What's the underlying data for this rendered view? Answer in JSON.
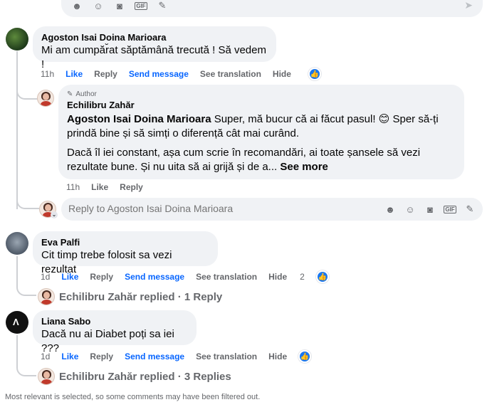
{
  "top_composer": {
    "icons": [
      "avatar-sticker-icon",
      "emoji-icon",
      "camera-icon",
      "gif-icon",
      "sticker-icon",
      "send-icon"
    ]
  },
  "comments": [
    {
      "author": "Agoston Isai Doina Marioara",
      "text": "Mi am cumpăr̆at săptămână trecută ! Să vedem !",
      "time": "11h",
      "like": "Like",
      "reply": "Reply",
      "send_message": "Send message",
      "see_translation": "See translation",
      "hide": "Hide"
    },
    {
      "author": "Eva Palfi",
      "text": "Cit timp trebe folosit sa vezi rezultat",
      "time": "1d",
      "like": "Like",
      "reply": "Reply",
      "send_message": "Send message",
      "see_translation": "See translation",
      "hide": "Hide",
      "reaction_count": "2",
      "replies_summary": "Echilibru Zahăr replied · 1 Reply"
    },
    {
      "author": "Liana Sabo",
      "text": "Dacă nu ai Diabet poți sa iei ???",
      "time": "1d",
      "like": "Like",
      "reply": "Reply",
      "send_message": "Send message",
      "see_translation": "See translation",
      "hide": "Hide",
      "replies_summary": "Echilibru Zahăr replied · 3 Replies"
    }
  ],
  "author_reply": {
    "badge": "Author",
    "name": "Echilibru Zahăr",
    "mention": "Agoston Isai Doina Marioara",
    "text_part1": " Super, mă bucur că ai făcut pasul! 😊 Sper să-ți prindă bine și să simți o diferență cât mai curând.",
    "text_part2": "Dacă îl iei constant, așa cum scrie în recomandări, ai toate șansele să vezi rezultate bune. Și nu uita să ai grijă și de a...",
    "see_more": "See more",
    "time": "11h",
    "like": "Like",
    "reply": "Reply"
  },
  "reply_box": {
    "placeholder": "Reply to Agoston Isai Doina Marioara"
  },
  "footer": {
    "note": "Most relevant is selected, so some comments may have been filtered out."
  },
  "colors": {
    "link_blue": "#0866ff",
    "like_blue": "#1877f2",
    "bubble_bg": "#f0f2f5",
    "muted_text": "#65676b"
  }
}
